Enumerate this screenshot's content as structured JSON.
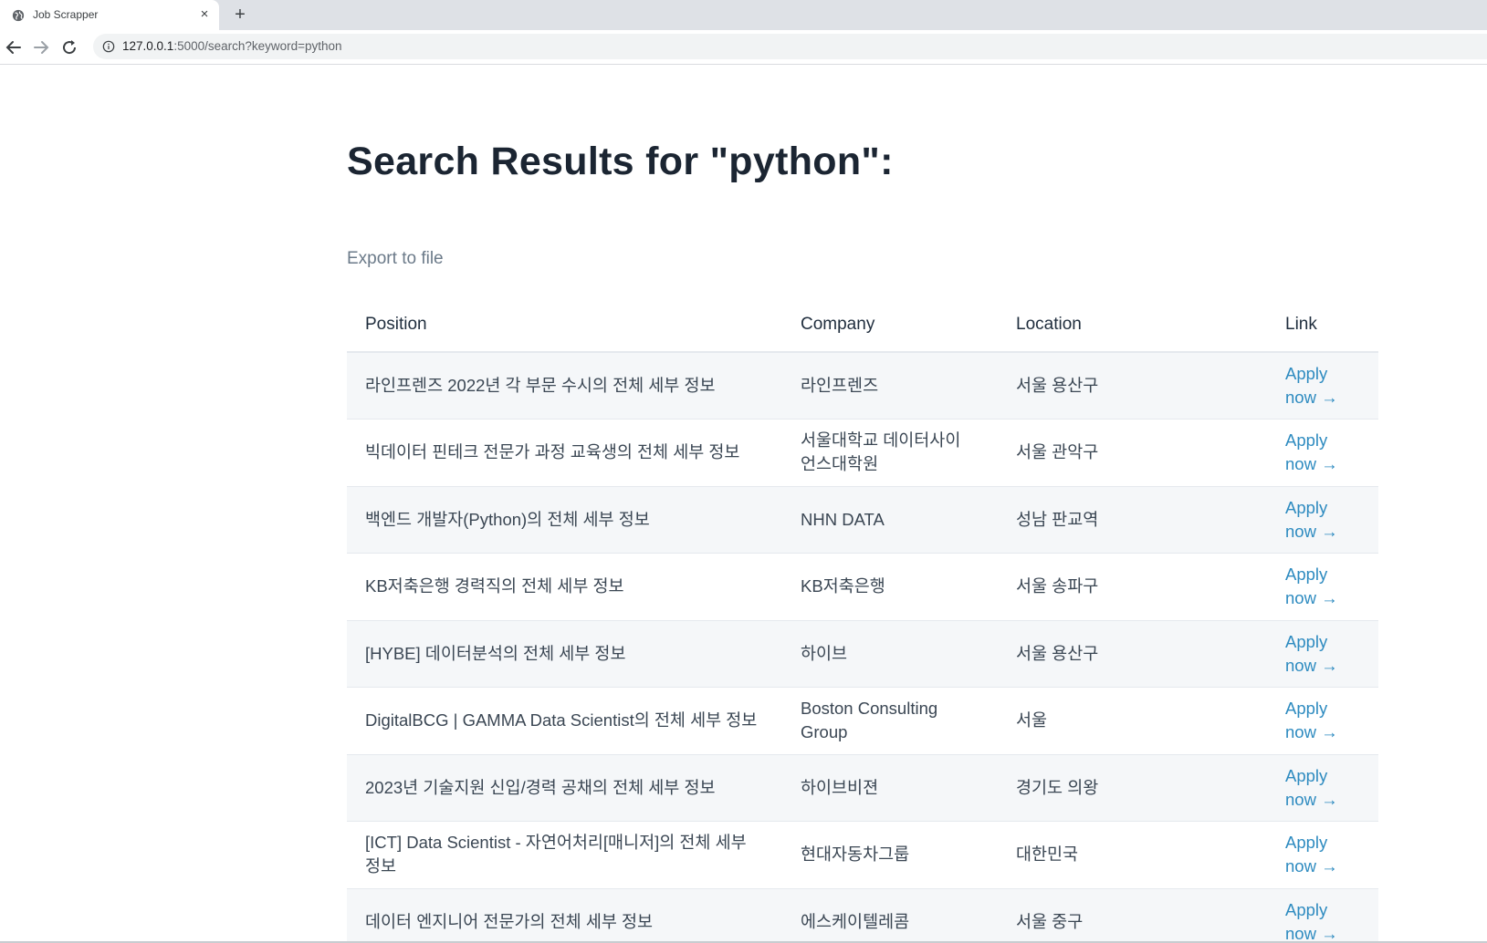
{
  "browser": {
    "tab_title": "Job Scrapper",
    "tab_close": "×",
    "new_tab": "+",
    "url_host": "127.0.0.1",
    "url_path": ":5000/search?keyword=python",
    "icons": {
      "favicon": "globe-icon",
      "back": "back-arrow-icon",
      "forward": "forward-arrow-icon",
      "reload": "reload-icon",
      "info": "info-icon"
    }
  },
  "page": {
    "title": "Search Results for \"python\":",
    "export_label": "Export to file",
    "columns": [
      "Position",
      "Company",
      "Location",
      "Link"
    ],
    "rows": [
      {
        "position": "라인프렌즈 2022년 각 부문 수시의 전체 세부 정보",
        "company": "라인프렌즈",
        "location": "서울 용산구",
        "link": "Apply now →"
      },
      {
        "position": "빅데이터 핀테크 전문가 과정 교육생의 전체 세부 정보",
        "company": "서울대학교 데이터사이언스대학원",
        "location": "서울 관악구",
        "link": "Apply now →"
      },
      {
        "position": "백엔드 개발자(Python)의 전체 세부 정보",
        "company": "NHN DATA",
        "location": "성남 판교역",
        "link": "Apply now →"
      },
      {
        "position": "KB저축은행 경력직의 전체 세부 정보",
        "company": "KB저축은행",
        "location": "서울 송파구",
        "link": "Apply now →"
      },
      {
        "position": "[HYBE] 데이터분석의 전체 세부 정보",
        "company": "하이브",
        "location": "서울 용산구",
        "link": "Apply now →"
      },
      {
        "position": "DigitalBCG | GAMMA Data Scientist의 전체 세부 정보",
        "company": "Boston Consulting Group",
        "location": "서울",
        "link": "Apply now →"
      },
      {
        "position": "2023년 기술지원 신입/경력 공채의 전체 세부 정보",
        "company": "하이브비젼",
        "location": "경기도 의왕",
        "link": "Apply now →"
      },
      {
        "position": "[ICT] Data Scientist - 자연어처리[매니저]의 전체 세부 정보",
        "company": "현대자동차그룹",
        "location": "대한민국",
        "link": "Apply now →"
      },
      {
        "position": "데이터 엔지니어 전문가의 전체 세부 정보",
        "company": "에스케이텔레콤",
        "location": "서울 중구",
        "link": "Apply now →"
      }
    ]
  },
  "colors": {
    "heading": "#1b2532",
    "link": "#2e8bc0",
    "muted": "#6b7a89",
    "stripe": "#f5f7f9"
  }
}
